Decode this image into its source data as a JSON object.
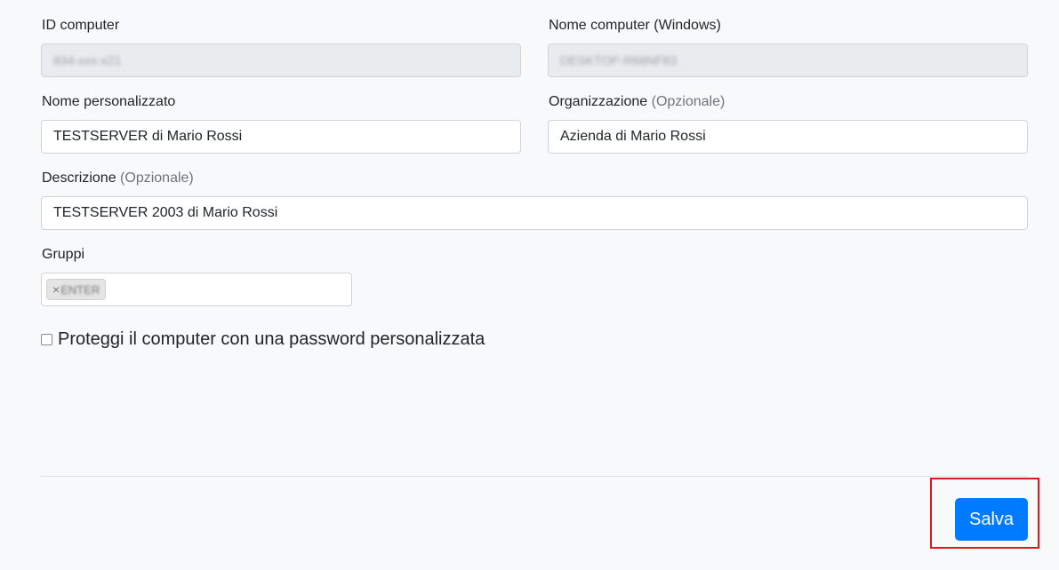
{
  "form": {
    "computer_id": {
      "label": "ID computer",
      "value": "834-xxx-x21"
    },
    "windows_name": {
      "label": "Nome computer (Windows)",
      "value": "DESKTOP-R68NF83"
    },
    "custom_name": {
      "label": "Nome personalizzato",
      "value": "TESTSERVER di Mario Rossi"
    },
    "organization": {
      "label": "Organizzazione",
      "optional": "(Opzionale)",
      "value": "Azienda di Mario Rossi"
    },
    "description": {
      "label": "Descrizione",
      "optional": "(Opzionale)",
      "value": "TESTSERVER 2003 di Mario Rossi"
    },
    "groups": {
      "label": "Gruppi",
      "tags": [
        {
          "remove": "×",
          "text": "ENTER"
        }
      ]
    },
    "password_protect": {
      "label": "Proteggi il computer con una password personalizzata",
      "checked": false
    }
  },
  "actions": {
    "save_label": "Salva"
  },
  "colors": {
    "primary": "#007bff",
    "highlight": "#e3141b",
    "readonly_bg": "#e9ecef"
  }
}
